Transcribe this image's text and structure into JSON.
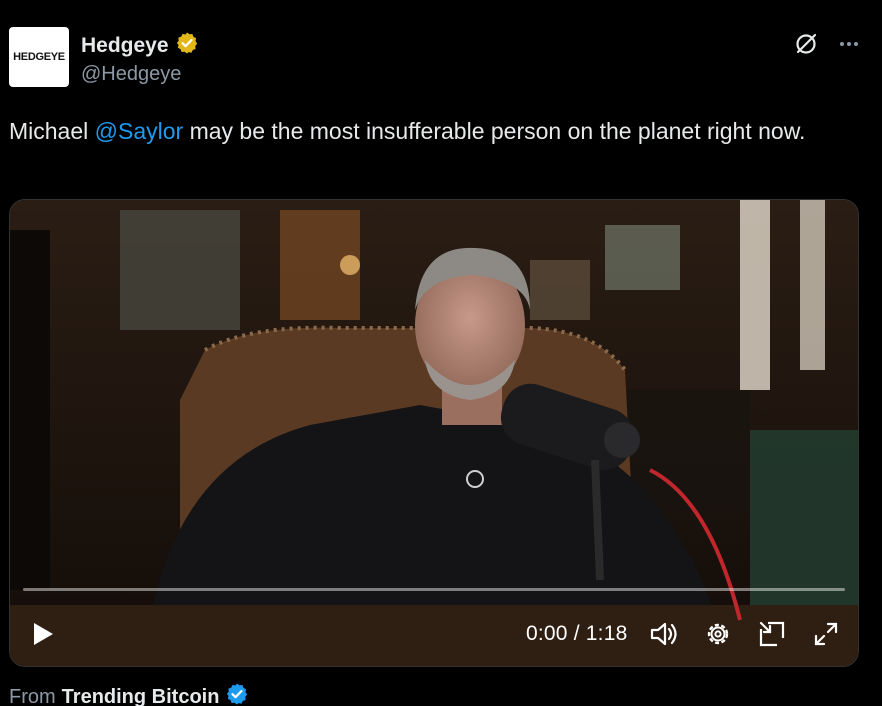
{
  "account": {
    "avatar_text": "HEDGEYE",
    "display_name": "Hedgeye",
    "handle": "@Hedgeye",
    "verified_badge_color": "#e2b719"
  },
  "top_actions": {
    "grok_icon": "grok-icon",
    "more_icon": "more-icon"
  },
  "tweet": {
    "text_before": "Michael ",
    "mention": "@Saylor",
    "text_after": " may be the most insufferable person on the planet right now."
  },
  "video": {
    "current_time": "0:00",
    "duration": "1:18",
    "time_display": "0:00 / 1:18",
    "progress_fraction": 0,
    "controls": [
      "play-icon",
      "volume-icon",
      "settings-icon",
      "pip-icon",
      "fullscreen-icon"
    ]
  },
  "source": {
    "prefix": "From",
    "name": "Trending Bitcoin",
    "badge_color": "#1d9bf0"
  },
  "colors": {
    "background": "#000000",
    "text": "#e7e9ea",
    "secondary": "#8b98a5",
    "link": "#1d9bf0"
  }
}
